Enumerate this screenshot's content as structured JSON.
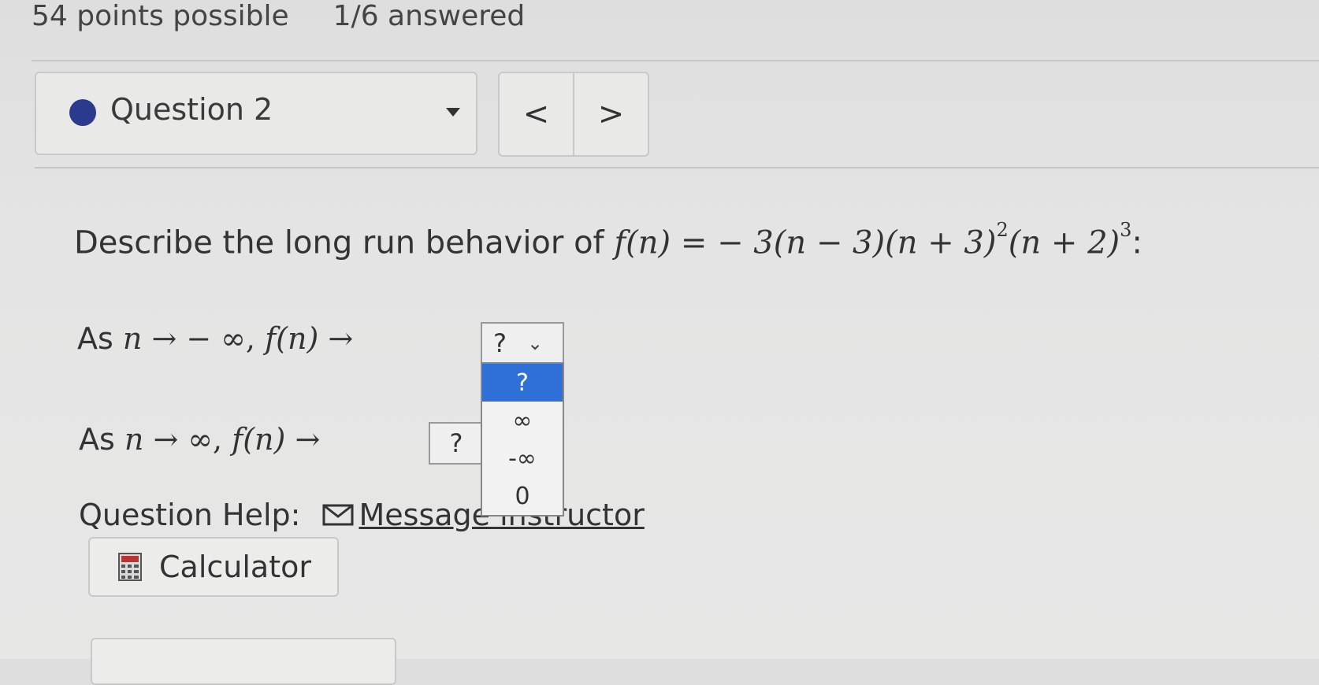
{
  "status": {
    "points": "54 points possible",
    "answered": "1/6 answered"
  },
  "question_select": {
    "label": "Question 2"
  },
  "nav": {
    "prev": "<",
    "next": ">"
  },
  "prompt": {
    "text": "Describe the long run behavior of ",
    "func": "f(n) = − 3(n − 3)(n + 3)",
    "exp1": "2",
    "tail": "(n + 2)",
    "exp2": "3",
    "end": ":"
  },
  "rows": [
    {
      "lead": "As ",
      "var": "n",
      "arrow": " → − ∞, ",
      "f": "f(n)",
      "arrow2": " →"
    },
    {
      "lead": "As ",
      "var": "n",
      "arrow": " → ∞, ",
      "f": "f(n)",
      "arrow2": " →"
    }
  ],
  "select1": {
    "value": "?",
    "options": [
      "?",
      "∞",
      "-∞",
      "0"
    ]
  },
  "select2": {
    "value": "?"
  },
  "help": {
    "label": "Question Help:",
    "link": "Message instructor"
  },
  "calculator": {
    "label": "Calculator"
  },
  "colors": {
    "dot": "#2b3a8c",
    "highlight": "#2f6fd8"
  }
}
